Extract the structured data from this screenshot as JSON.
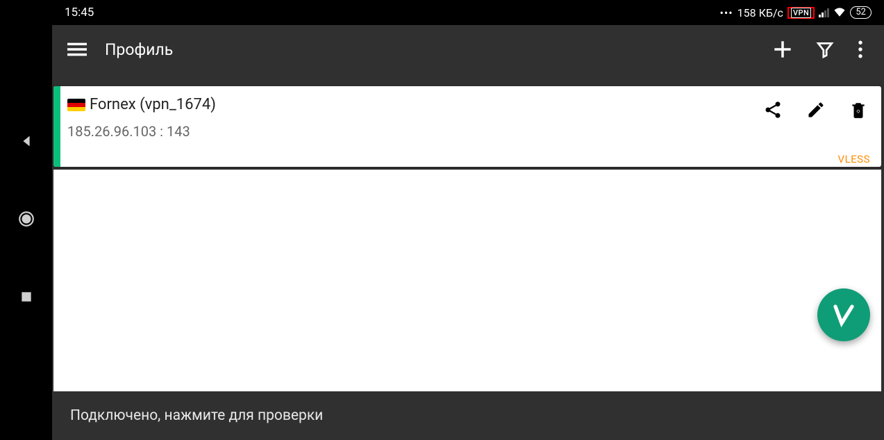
{
  "statusbar": {
    "time": "15:45",
    "speed": "158 КБ/с",
    "vpn_label": "VPN",
    "battery": "52"
  },
  "toolbar": {
    "title": "Профиль"
  },
  "profile": {
    "name": "Fornex (vpn_1674)",
    "address": "185.26.96.103 : 143",
    "protocol": "VLESS"
  },
  "bottom_status": "Подключено, нажмите для проверки"
}
